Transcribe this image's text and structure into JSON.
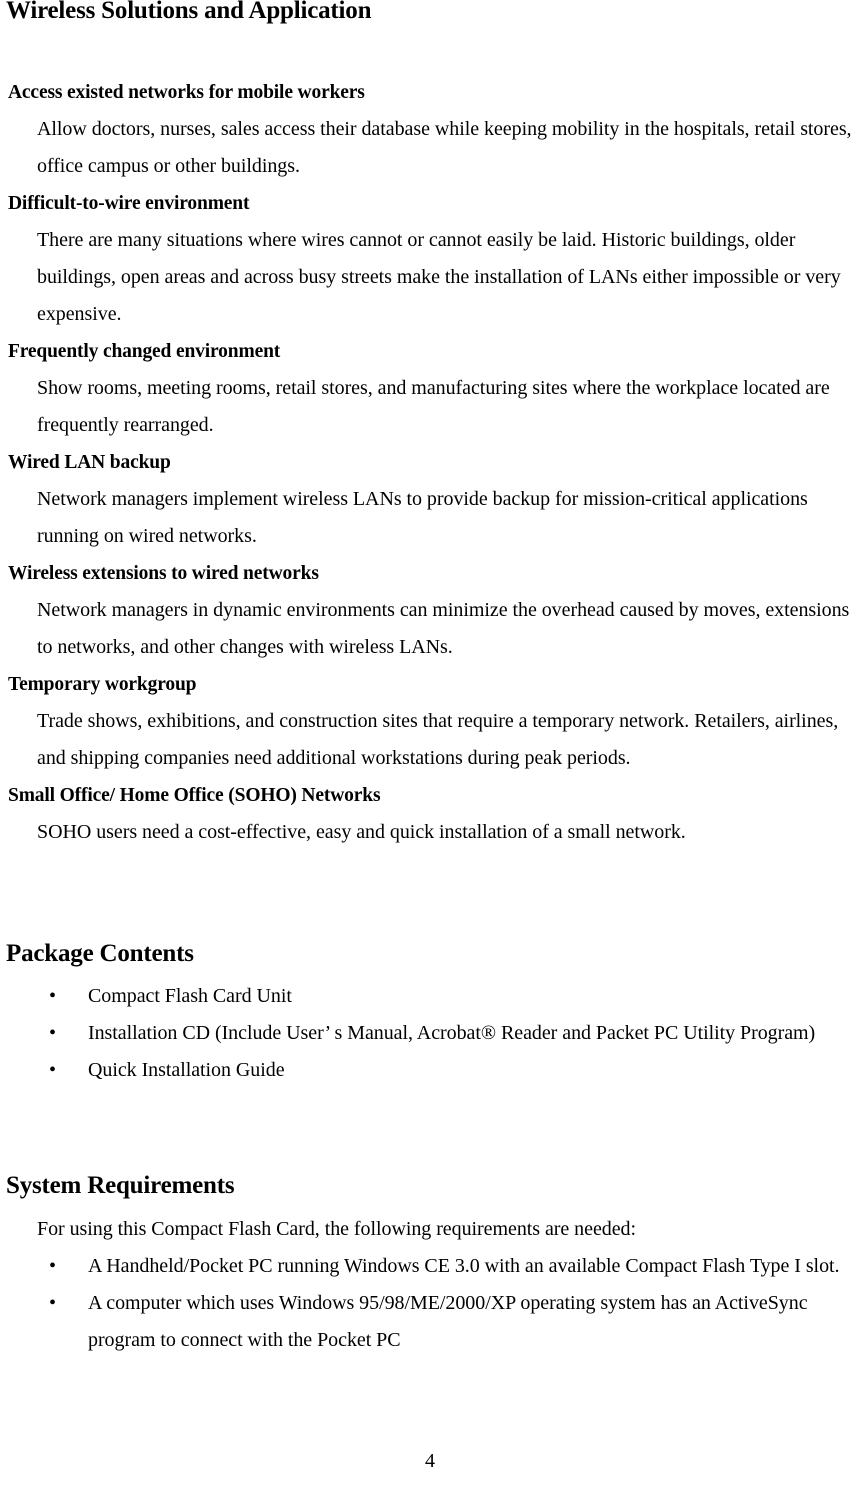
{
  "document": {
    "page_number": "4",
    "sections": [
      {
        "id": "wireless_solutions",
        "heading": "Wireless Solutions and Application",
        "entries": [
          {
            "subheading": "Access existed networks for mobile workers",
            "body": "Allow doctors, nurses, sales access their database while keeping mobility in the hospitals, retail stores, office campus or other buildings."
          },
          {
            "subheading": "Difficult-to-wire environment",
            "body": "There are many situations where wires cannot or cannot easily be laid. Historic buildings, older buildings, open areas and across busy streets make the installation of LANs either impossible or very expensive."
          },
          {
            "subheading": "Frequently changed environment",
            "body": "Show rooms, meeting rooms, retail stores, and manufacturing sites where the workplace located are frequently rearranged."
          },
          {
            "subheading": "Wired LAN backup",
            "body": "Network managers implement wireless LANs to provide backup for mission-critical applications running on wired networks."
          },
          {
            "subheading": "Wireless extensions to wired networks",
            "body": "Network managers in dynamic environments can minimize the overhead caused by moves, extensions to networks, and other changes with wireless LANs."
          },
          {
            "subheading": "Temporary workgroup",
            "body": "Trade shows, exhibitions, and construction sites that require a temporary network. Retailers, airlines, and shipping companies need additional workstations during peak periods."
          },
          {
            "subheading": "Small Office/ Home Office (SOHO) Networks",
            "body": "SOHO users need a cost-effective, easy and quick installation of a small network."
          }
        ]
      },
      {
        "id": "package_contents",
        "heading": "Package Contents",
        "bullet_glyph": "•",
        "items": [
          "Compact Flash Card Unit",
          "Installation CD (Include User’ s Manual, Acrobat® Reader and Packet PC Utility Program)",
          "Quick Installation Guide"
        ]
      },
      {
        "id": "system_requirements",
        "heading": "System Requirements",
        "intro": "For using this Compact Flash Card, the following requirements are needed:",
        "bullet_glyph": "•",
        "items": [
          "A Handheld/Pocket PC running Windows CE 3.0 with an available Compact Flash Type I slot.",
          "A computer which uses Windows 95/98/ME/2000/XP operating system has an ActiveSync program to connect with the Pocket PC"
        ]
      }
    ]
  }
}
